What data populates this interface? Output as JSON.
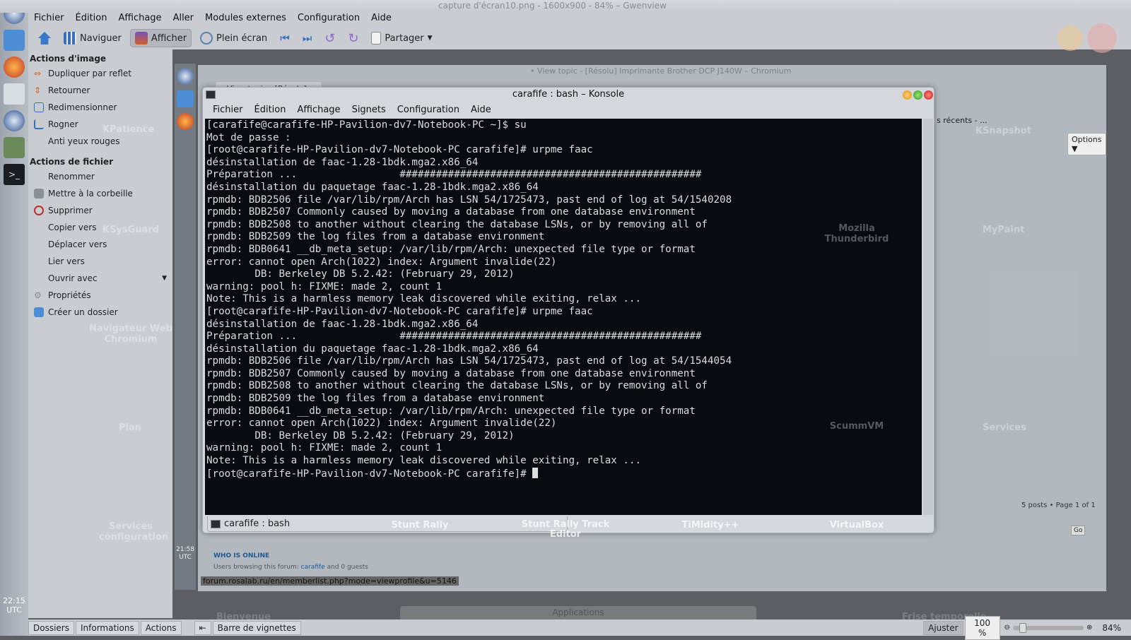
{
  "window": {
    "title": "capture d'écran10.png - 1600x900 - 84% – Gwenview"
  },
  "menubar": [
    "Fichier",
    "Édition",
    "Affichage",
    "Aller",
    "Modules externes",
    "Configuration",
    "Aide"
  ],
  "toolbar": {
    "browse": "Naviguer",
    "view": "Afficher",
    "fullscreen": "Plein écran",
    "share": "Partager"
  },
  "sidebar": {
    "image_actions_title": "Actions d'image",
    "image_actions": [
      "Dupliquer par reflet",
      "Retourner",
      "Redimensionner",
      "Rogner",
      "Anti yeux rouges"
    ],
    "file_actions_title": "Actions de fichier",
    "file_actions": [
      "Renommer",
      "Mettre à la corbeille",
      "Supprimer",
      "Copier vers",
      "Déplacer vers",
      "Lier vers",
      "Ouvrir avec",
      "Propriétés",
      "Créer un dossier"
    ]
  },
  "panel": {
    "clock": "22:15",
    "tz": "UTC",
    "clock2": "21:58",
    "tz2": "UTC"
  },
  "chromium": {
    "title": "• View topic - [Résolu] Imprimante Brother DCP J140W – Chromium",
    "tab": "• View topic - [Résolu] Im",
    "recent": "s récents - ...",
    "options": "Options ▼",
    "pages": "5 posts • Page 1 of 1",
    "go": "Go",
    "who_online": "WHO IS ONLINE",
    "browsing": "Users browsing this forum: ",
    "user": "carafife",
    "guests": " and 0 guests",
    "status_url": "forum.rosalab.ru/en/memberlist.php?mode=viewprofile&u=5146"
  },
  "desktop": {
    "labels": [
      "KPatience",
      "KSysGuard",
      "Navigateur Web Chromium",
      "Plan",
      "Services configuration",
      "Stunt Rally",
      "Stunt Rally Track Editor",
      "TiMidity++",
      "VirtualBox",
      "Mozilla Thunderbird",
      "ScummVM",
      "KSnapshot",
      "MyPaint",
      "Services"
    ],
    "tabs": [
      "Bienvenue",
      "Applications",
      "Frise temporelle"
    ]
  },
  "konsole": {
    "title": "carafife : bash – Konsole",
    "menu": [
      "Fichier",
      "Édition",
      "Affichage",
      "Signets",
      "Configuration",
      "Aide"
    ],
    "tab": "carafife : bash",
    "lines": [
      "[carafife@carafife-HP-Pavilion-dv7-Notebook-PC ~]$ su",
      "Mot de passe :",
      "[root@carafife-HP-Pavilion-dv7-Notebook-PC carafife]# urpme faac",
      "désinstallation de faac-1.28-1bdk.mga2.x86_64",
      "Préparation ...                 ##################################################",
      "désinstallation du paquetage faac-1.28-1bdk.mga2.x86_64",
      "rpmdb: BDB2506 file /var/lib/rpm/Arch has LSN 54/1725473, past end of log at 54/1540208",
      "rpmdb: BDB2507 Commonly caused by moving a database from one database environment",
      "rpmdb: BDB2508 to another without clearing the database LSNs, or by removing all of",
      "rpmdb: BDB2509 the log files from a database environment",
      "rpmdb: BDB0641 __db_meta_setup: /var/lib/rpm/Arch: unexpected file type or format",
      "error: cannot open Arch(1022) index: Argument invalide(22)",
      "        DB: Berkeley DB 5.2.42: (February 29, 2012)",
      "warning: pool h: FIXME: made 2, count 1",
      "Note: This is a harmless memory leak discovered while exiting, relax ...",
      "[root@carafife-HP-Pavilion-dv7-Notebook-PC carafife]# urpme faac",
      "désinstallation de faac-1.28-1bdk.mga2.x86_64",
      "Préparation ...                 ##################################################",
      "désinstallation du paquetage faac-1.28-1bdk.mga2.x86_64",
      "rpmdb: BDB2506 file /var/lib/rpm/Arch has LSN 54/1725473, past end of log at 54/1544054",
      "rpmdb: BDB2507 Commonly caused by moving a database from one database environment",
      "rpmdb: BDB2508 to another without clearing the database LSNs, or by removing all of",
      "rpmdb: BDB2509 the log files from a database environment",
      "rpmdb: BDB0641 __db_meta_setup: /var/lib/rpm/Arch: unexpected file type or format",
      "error: cannot open Arch(1022) index: Argument invalide(22)",
      "        DB: Berkeley DB 5.2.42: (February 29, 2012)",
      "warning: pool h: FIXME: made 2, count 1",
      "Note: This is a harmless memory leak discovered while exiting, relax ..."
    ],
    "prompt": "[root@carafife-HP-Pavilion-dv7-Notebook-PC carafife]# "
  },
  "bottombar": {
    "tabs": [
      "Dossiers",
      "Informations",
      "Actions"
    ],
    "thumbnails": "Barre de vignettes",
    "fit": "Ajuster",
    "zoom_field": "100 %",
    "zoom": "84%",
    "zoom_slider_fraction": 0.1
  }
}
